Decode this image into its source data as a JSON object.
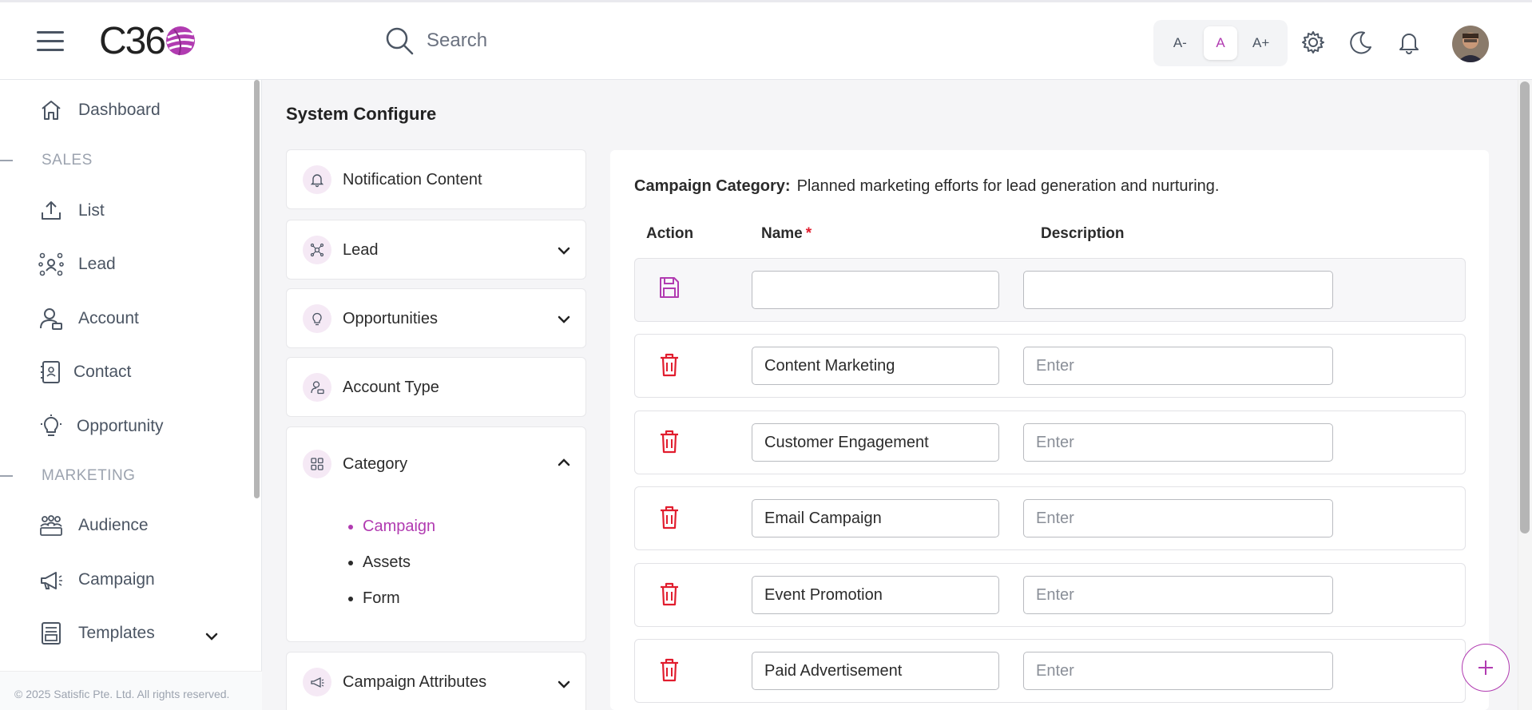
{
  "header": {
    "logo_text": "C36",
    "search_placeholder": "Search",
    "font_small": "A-",
    "font_normal": "A",
    "font_large": "A+"
  },
  "sidebar": {
    "items": [
      {
        "label": "Dashboard",
        "icon": "home-icon"
      },
      {
        "label": "List",
        "icon": "upload-icon"
      },
      {
        "label": "Lead",
        "icon": "lead-network-icon"
      },
      {
        "label": "Account",
        "icon": "account-user-icon"
      },
      {
        "label": "Contact",
        "icon": "contact-book-icon"
      },
      {
        "label": "Opportunity",
        "icon": "lightbulb-icon"
      },
      {
        "label": "Audience",
        "icon": "audience-group-icon"
      },
      {
        "label": "Campaign",
        "icon": "megaphone-icon"
      },
      {
        "label": "Templates",
        "icon": "templates-icon"
      }
    ],
    "section_sales": "SALES",
    "section_marketing": "MARKETING",
    "footer": "© 2025 Satisfic Pte. Ltd. All rights reserved."
  },
  "main": {
    "page_title": "System Configure",
    "config_items": [
      {
        "label": "Notification Content"
      },
      {
        "label": "Lead"
      },
      {
        "label": "Opportunities"
      },
      {
        "label": "Account Type"
      },
      {
        "label": "Category"
      },
      {
        "label": "Campaign Attributes"
      }
    ],
    "category_sub": [
      "Campaign",
      "Assets",
      "Form"
    ],
    "panel": {
      "title": "Campaign Category:",
      "description": "Planned marketing efforts for lead generation and nurturing.",
      "col_action": "Action",
      "col_name": "Name",
      "col_required": "*",
      "col_description": "Description",
      "desc_placeholder": "Enter",
      "rows": [
        {
          "name": "Content Marketing"
        },
        {
          "name": "Customer Engagement"
        },
        {
          "name": "Email Campaign"
        },
        {
          "name": "Event Promotion"
        },
        {
          "name": "Paid Advertisement"
        }
      ]
    }
  },
  "colors": {
    "accent": "#b13bb1",
    "danger": "#e11d2e",
    "muted": "#9ca3af"
  }
}
